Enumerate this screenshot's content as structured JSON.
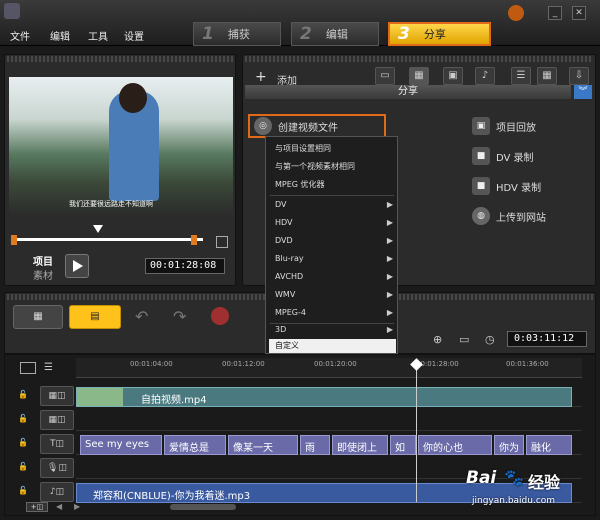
{
  "menu": {
    "items": [
      "文件",
      "编辑",
      "工具",
      "设置"
    ]
  },
  "steps": [
    {
      "num": "1",
      "label": "捕获"
    },
    {
      "num": "2",
      "label": "编辑"
    },
    {
      "num": "3",
      "label": "分享"
    }
  ],
  "window": {
    "help_icon": "help-icon",
    "minimize": "_",
    "close": "✕"
  },
  "preview": {
    "subtitle": "我们还要很远路走不知道啊",
    "mode_project": "项目",
    "mode_clip": "素材",
    "timecode": "00:01:28:08"
  },
  "library": {
    "add_label": "添加",
    "share_header": "分享"
  },
  "share_options": {
    "create_video": "创建视频文件",
    "project_playback": "项目回放",
    "dv_record": "DV 录制",
    "hdv_record": "HDV 录制",
    "upload_web": "上传到网站"
  },
  "dropdown": {
    "items": [
      {
        "label": "与项目设置相同",
        "arrow": ""
      },
      {
        "label": "与第一个视频素材相同",
        "arrow": ""
      },
      {
        "label": "MPEG 优化器",
        "arrow": ""
      },
      {
        "label": "DV",
        "arrow": "▶"
      },
      {
        "label": "HDV",
        "arrow": "▶"
      },
      {
        "label": "DVD",
        "arrow": "▶"
      },
      {
        "label": "Blu-ray",
        "arrow": "▶"
      },
      {
        "label": "AVCHD",
        "arrow": "▶"
      },
      {
        "label": "WMV",
        "arrow": "▶"
      },
      {
        "label": "MPEG-4",
        "arrow": "▶"
      },
      {
        "label": "3D",
        "arrow": "▶"
      },
      {
        "label": "自定义",
        "arrow": ""
      }
    ]
  },
  "timeline": {
    "duration": "0:03:11:12",
    "ruler": [
      "00:01:04:00",
      "00:01:12:00",
      "00:01:20:00",
      "00:01:28:00",
      "00:01:36:00"
    ],
    "video_clip": "自拍视频.mp4",
    "title_clips": [
      "See my eyes",
      "爱情总是",
      "像某一天",
      "雨",
      "即使闭上",
      "如",
      "你的心也",
      "你为",
      "融化"
    ],
    "music_clip": "郑容和(CNBLUE)-你为我着迷.mp3"
  },
  "watermark": {
    "brand": "Bai",
    "brand2": "经验",
    "url": "jingyan.baidu.com"
  },
  "colors": {
    "accent": "#ffc21a",
    "highlight": "#e06a1a",
    "selection_blue": "#4a6aa0"
  }
}
